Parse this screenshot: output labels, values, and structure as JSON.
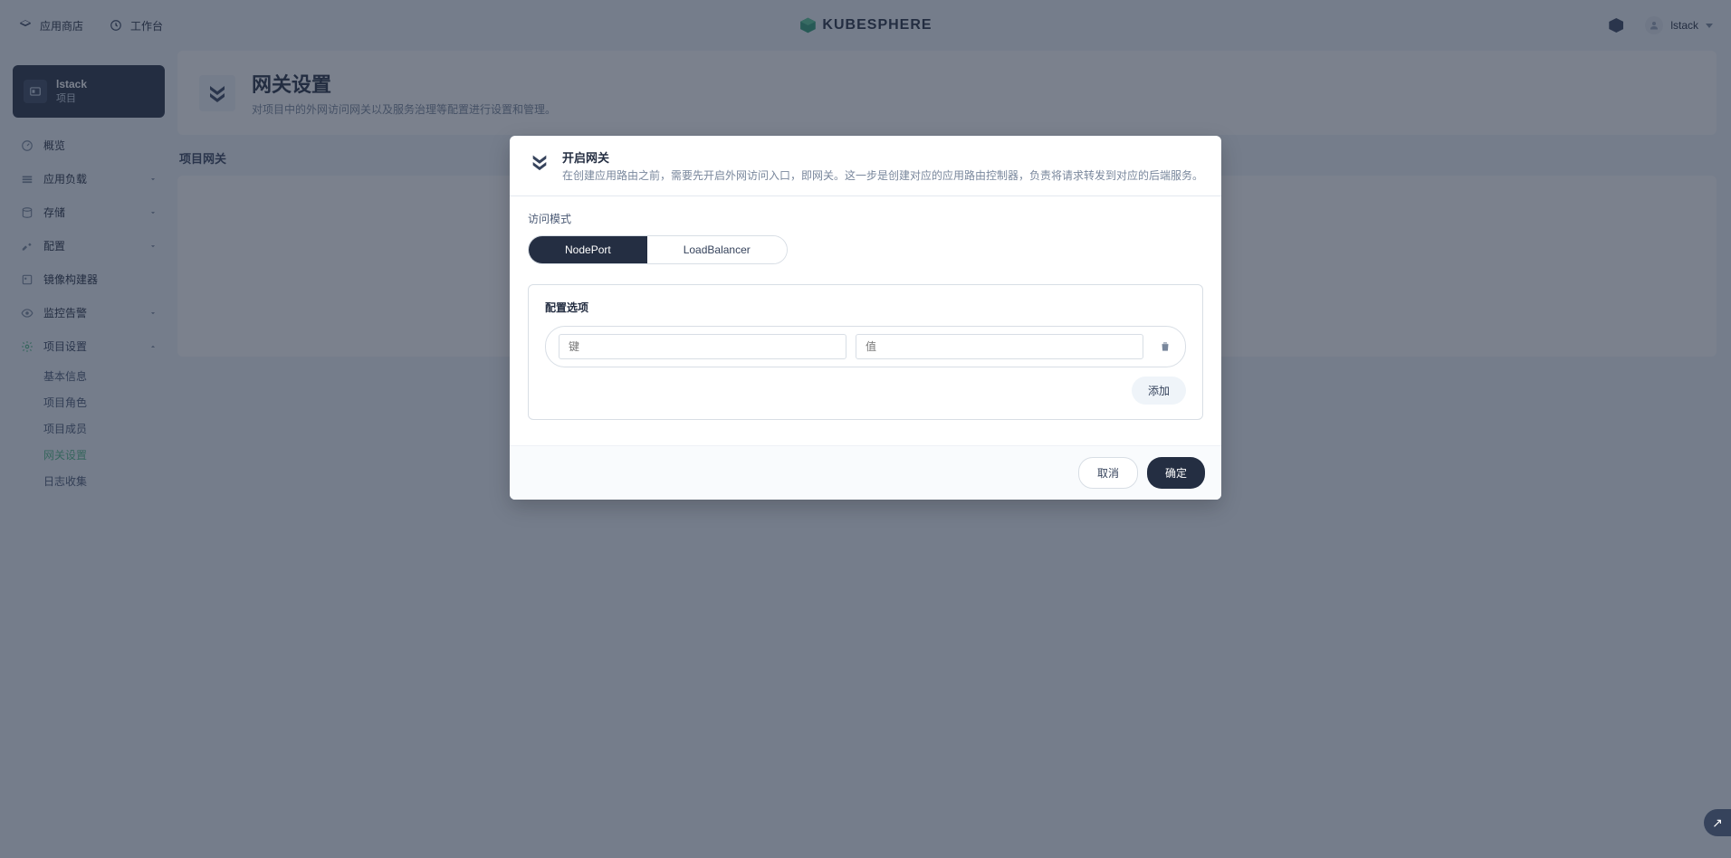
{
  "topbar": {
    "appstore": "应用商店",
    "workbench": "工作台",
    "brand": "KUBESPHERE",
    "user": "lstack"
  },
  "sidebar": {
    "project_name": "lstack",
    "project_label": "项目",
    "items": [
      {
        "label": "概览"
      },
      {
        "label": "应用负载"
      },
      {
        "label": "存储"
      },
      {
        "label": "配置"
      },
      {
        "label": "镜像构建器"
      },
      {
        "label": "监控告警"
      },
      {
        "label": "项目设置"
      }
    ],
    "settings_sub": [
      {
        "label": "基本信息"
      },
      {
        "label": "项目角色"
      },
      {
        "label": "项目成员"
      },
      {
        "label": "网关设置"
      },
      {
        "label": "日志收集"
      }
    ]
  },
  "page": {
    "title": "网关设置",
    "subtitle": "对项目中的外网访问网关以及服务治理等配置进行设置和管理。",
    "section_label": "项目网关"
  },
  "modal": {
    "title": "开启网关",
    "desc": "在创建应用路由之前，需要先开启外网访问入口，即网关。这一步是创建对应的应用路由控制器，负责将请求转发到对应的后端服务。",
    "access_mode_label": "访问模式",
    "modes": {
      "nodeport": "NodePort",
      "loadbalancer": "LoadBalancer"
    },
    "config_title": "配置选项",
    "key_placeholder": "键",
    "value_placeholder": "值",
    "add_label": "添加",
    "cancel": "取消",
    "confirm": "确定"
  },
  "fab": {
    "glyph": "↗"
  }
}
